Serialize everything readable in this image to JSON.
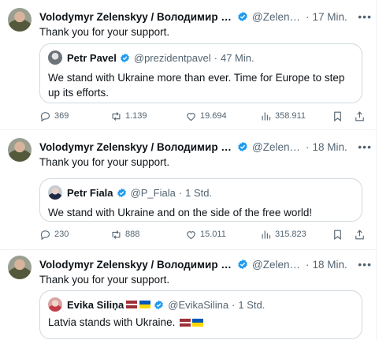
{
  "colors": {
    "verified": "#1d9bf0",
    "secondary_text": "#536471",
    "border": "#cfd9de"
  },
  "tweets": [
    {
      "author": "Volodymyr Zelenskyy / Володимир Зеленський",
      "handle": "@ZelenskyyUa",
      "time": "17 Min.",
      "text": "Thank you for your support.",
      "quote": {
        "author": "Petr Pavel",
        "handle": "@prezidentpavel",
        "time": "47 Min.",
        "text": "We stand with Ukraine more than ever. Time for Europe to step up its efforts.",
        "flags": []
      },
      "stats": {
        "replies": "369",
        "reposts": "1.139",
        "likes": "19.694",
        "views": "358.911"
      }
    },
    {
      "author": "Volodymyr Zelenskyy / Володимир Зеленський",
      "handle": "@ZelenskyyUa",
      "time": "18 Min.",
      "text": "Thank you for your support.",
      "quote": {
        "author": "Petr Fiala",
        "handle": "@P_Fiala",
        "time": "1 Std.",
        "text": "We stand with Ukraine and on the side of the free world!",
        "flags": []
      },
      "stats": {
        "replies": "230",
        "reposts": "888",
        "likes": "15.011",
        "views": "315.823"
      }
    },
    {
      "author": "Volodymyr Zelenskyy / Володимир Зеленський",
      "handle": "@ZelenskyyUa",
      "time": "18 Min.",
      "text": "Thank you for your support.",
      "quote": {
        "author": "Evika Siliņa",
        "name_flags": [
          "latvia-flag",
          "ukraine-flag"
        ],
        "handle": "@EvikaSilina",
        "time": "1 Std.",
        "text": "Latvia stands with Ukraine.",
        "flags": [
          "latvia-flag",
          "ukraine-flag"
        ]
      },
      "stats": null
    }
  ],
  "separator": "·",
  "more_icon": "more-horizontal-icon"
}
